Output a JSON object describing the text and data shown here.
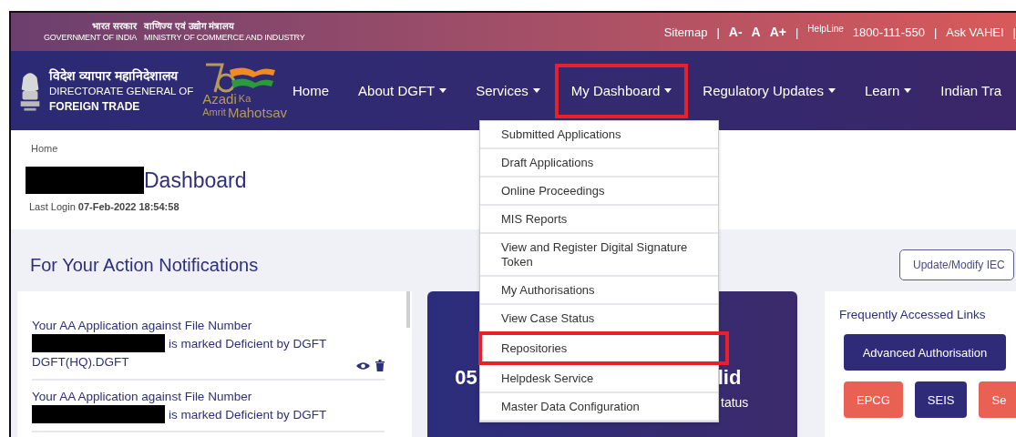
{
  "top_bar": {
    "hindi_left": "भारत सरकार",
    "hindi_right": "वाणिज्य एवं उद्योग मंत्रालय",
    "english_left": "GOVERNMENT OF INDIA",
    "english_right": "MINISTRY OF COMMERCE AND INDUSTRY",
    "links": [
      {
        "kind": "link",
        "text": "Sitemap"
      },
      {
        "kind": "sep",
        "text": "|"
      },
      {
        "kind": "font",
        "text": "A-"
      },
      {
        "kind": "font",
        "text": "A"
      },
      {
        "kind": "font",
        "text": "A+"
      },
      {
        "kind": "sep",
        "text": "|"
      },
      {
        "kind": "small",
        "text": "HelpLine"
      },
      {
        "kind": "link",
        "text": "1800-111-550"
      },
      {
        "kind": "sep",
        "text": "|"
      },
      {
        "kind": "link",
        "text": "Ask VAHEI"
      },
      {
        "kind": "sep",
        "text": "|"
      }
    ]
  },
  "brand": {
    "hindi": "विदेश व्यापार महानिदेशालय",
    "line_1": "DIRECTORATE GENERAL OF",
    "line_2": "FOREIGN TRADE",
    "azadi": [
      "Azadi",
      "Ka",
      "Amrit",
      "Mahotsav"
    ]
  },
  "nav": [
    {
      "label": "Home",
      "dropdown": false,
      "highlighted": false
    },
    {
      "label": "About DGFT",
      "dropdown": true,
      "highlighted": false
    },
    {
      "label": "Services",
      "dropdown": true,
      "highlighted": false
    },
    {
      "label": "My Dashboard",
      "dropdown": true,
      "highlighted": true
    },
    {
      "label": "Regulatory Updates",
      "dropdown": true,
      "highlighted": false
    },
    {
      "label": "Learn",
      "dropdown": true,
      "highlighted": false
    },
    {
      "label": "Indian Tra",
      "dropdown": false,
      "highlighted": false
    }
  ],
  "dropdown_menu": [
    {
      "label": "Submitted Applications",
      "highlighted": false
    },
    {
      "label": "Draft Applications",
      "highlighted": false
    },
    {
      "label": "Online Proceedings",
      "highlighted": false
    },
    {
      "label": "MIS Reports",
      "highlighted": false
    },
    {
      "label": "View and Register Digital Signature Token",
      "highlighted": false
    },
    {
      "label": "My Authorisations",
      "highlighted": false
    },
    {
      "label": "View Case Status",
      "highlighted": false
    },
    {
      "label": "Repositories",
      "highlighted": true
    },
    {
      "label": "Helpdesk Service",
      "highlighted": false
    },
    {
      "label": "Master Data Configuration",
      "highlighted": false
    }
  ],
  "breadcrumb": "Home",
  "page_title": "Dashboard",
  "last_login": {
    "label": "Last Login",
    "value": "07-Feb-2022 18:54:58"
  },
  "notifications_heading": "For Your Action Notifications",
  "notifications": [
    {
      "line_1": "Your AA Application against File Number",
      "line_2": "is marked Deficient by DGFT",
      "line_3": "DGFT(HQ).DGFT",
      "actions": true
    },
    {
      "line_1": "Your AA Application against File Number",
      "line_2": "is marked Deficient by DGFT",
      "actions": false
    }
  ],
  "status_card": {
    "count": "05",
    "title_end": "lid",
    "subtitle_end": "tatus"
  },
  "update_button": "Update/Modify IEC",
  "links_card": {
    "title": "Frequently Accessed Links",
    "buttons": [
      {
        "label": "Advanced Authorisation",
        "color": "#2f2b78",
        "wide": true
      },
      {
        "label": "EPCG",
        "color": "#e96152",
        "wide": false
      },
      {
        "label": "SEIS",
        "color": "#2f2b78",
        "wide": false
      },
      {
        "label": "Se",
        "color": "#e96152",
        "wide": false
      }
    ]
  }
}
